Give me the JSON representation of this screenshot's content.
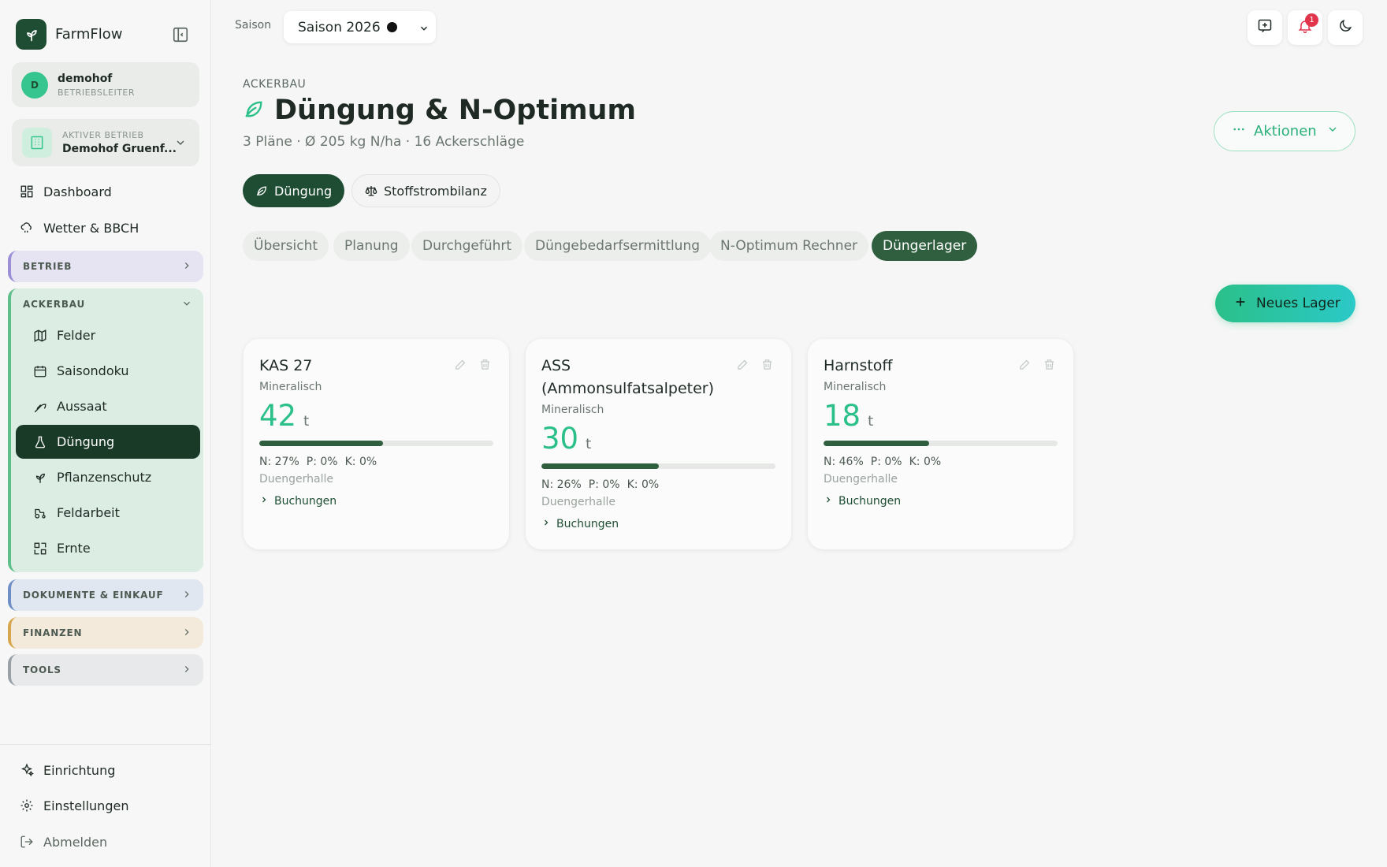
{
  "app": {
    "name": "FarmFlow"
  },
  "user": {
    "initial": "D",
    "name": "demohof",
    "role": "BETRIEBSLEITER"
  },
  "farm": {
    "label": "AKTIVER BETRIEB",
    "name": "Demohof Gruenf..."
  },
  "nav": {
    "dashboard": "Dashboard",
    "weather": "Wetter & BBCH",
    "groups": {
      "betrieb": "BETRIEB",
      "ackerbau": "ACKERBAU",
      "dokumente": "DOKUMENTE & EINKAUF",
      "finanzen": "FINANZEN",
      "tools": "TOOLS"
    },
    "ackerbau_items": [
      "Felder",
      "Saisondoku",
      "Aussaat",
      "Düngung",
      "Pflanzenschutz",
      "Feldarbeit",
      "Ernte"
    ],
    "active_item": "Düngung",
    "bottom": {
      "setup": "Einrichtung",
      "settings": "Einstellungen",
      "logout": "Abmelden"
    }
  },
  "header": {
    "season_label": "Saison",
    "season_value": "Saison 2026",
    "notification_count": "1"
  },
  "page": {
    "breadcrumb": "ACKERBAU",
    "title": "Düngung & N-Optimum",
    "subtitle": "3 Pläne · Ø 205 kg N/ha · 16 Ackerschläge",
    "actions_label": "Aktionen",
    "mode_pills": [
      "Düngung",
      "Stoffstrombilanz"
    ],
    "active_mode": "Düngung",
    "tabs": [
      "Übersicht",
      "Planung",
      "Durchgeführt",
      "Düngebedarfsermittlung",
      "N-Optimum Rechner",
      "Düngerlager"
    ],
    "active_tab": "Düngerlager",
    "new_button": "Neues Lager"
  },
  "storage_cards": [
    {
      "name": "KAS 27",
      "type": "Mineralisch",
      "amount": "42",
      "unit": "t",
      "fill_fraction": 0.53,
      "n": "N: 27%",
      "p": "P: 0%",
      "k": "K: 0%",
      "location": "Duengerhalle",
      "bookings": "Buchungen"
    },
    {
      "name": "ASS (Ammonsulfatsalpeter)",
      "type": "Mineralisch",
      "amount": "30",
      "unit": "t",
      "fill_fraction": 0.5,
      "n": "N: 26%",
      "p": "P: 0%",
      "k": "K: 0%",
      "location": "Duengerhalle",
      "bookings": "Buchungen"
    },
    {
      "name": "Harnstoff",
      "type": "Mineralisch",
      "amount": "18",
      "unit": "t",
      "fill_fraction": 0.45,
      "n": "N: 46%",
      "p": "P: 0%",
      "k": "K: 0%",
      "location": "Duengerhalle",
      "bookings": "Buchungen"
    }
  ],
  "colors": {
    "brand_dark": "#1e4d33",
    "accent_green": "#2bc089",
    "badge_red": "#e0354b"
  }
}
